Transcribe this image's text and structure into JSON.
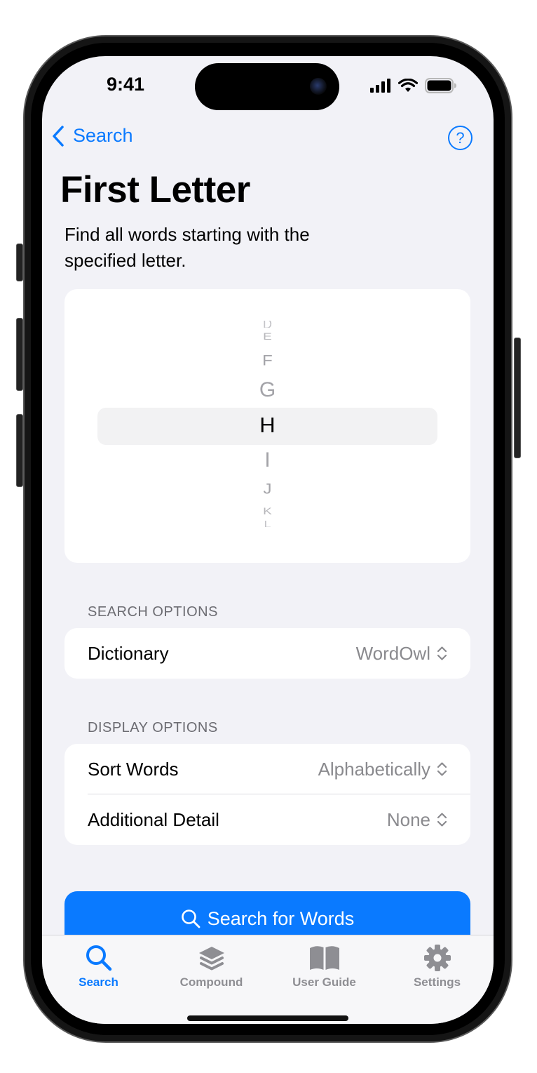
{
  "status_bar": {
    "time": "9:41"
  },
  "nav": {
    "back_label": "Search",
    "help_label": "?"
  },
  "page": {
    "title": "First Letter",
    "subtitle": "Find all words starting with the specified letter."
  },
  "picker": {
    "letters": [
      "D",
      "E",
      "F",
      "G",
      "H",
      "I",
      "J",
      "K",
      "L"
    ],
    "selected": "H"
  },
  "search_options": {
    "header": "SEARCH OPTIONS",
    "dictionary": {
      "label": "Dictionary",
      "value": "WordOwl"
    }
  },
  "display_options": {
    "header": "DISPLAY OPTIONS",
    "sort": {
      "label": "Sort Words",
      "value": "Alphabetically"
    },
    "detail": {
      "label": "Additional Detail",
      "value": "None"
    }
  },
  "search_button": {
    "label": "Search for Words"
  },
  "tabs": [
    {
      "label": "Search",
      "icon": "search-icon",
      "active": true
    },
    {
      "label": "Compound",
      "icon": "layers-icon",
      "active": false
    },
    {
      "label": "User Guide",
      "icon": "book-icon",
      "active": false
    },
    {
      "label": "Settings",
      "icon": "gear-icon",
      "active": false
    }
  ],
  "colors": {
    "accent": "#0a7aff",
    "background": "#f2f2f7",
    "secondary_text": "#8a8a8e"
  }
}
